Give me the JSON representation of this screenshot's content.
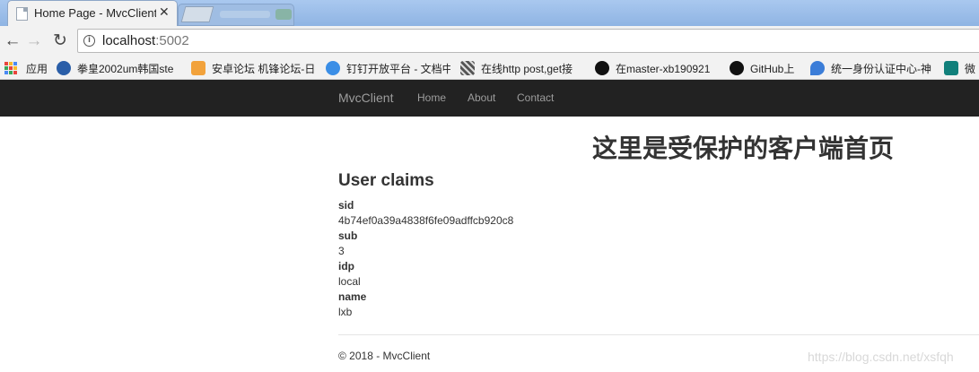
{
  "browser": {
    "tab": {
      "title": "Home Page - MvcClient",
      "close": "✕"
    },
    "toolbar": {
      "back": "←",
      "forward": "→",
      "reload": "↻"
    },
    "address": {
      "host": "localhost",
      "port": ":5002",
      "info": "i"
    },
    "bookmarks": [
      {
        "label": "应用",
        "icon": "apps-grid-icon"
      },
      {
        "label": "拳皇2002um韩国ste",
        "icon": "cloud-icon",
        "color": "#2a5ea8"
      },
      {
        "label": "安卓论坛 机锋论坛-日",
        "icon": "gfan-icon",
        "color": "#f2a23b"
      },
      {
        "label": "钉钉开放平台 - 文档中",
        "icon": "dingtalk-icon",
        "color": "#3a8ee6"
      },
      {
        "label": "在线http post,get接",
        "icon": "qrcode-icon",
        "color": "#555555"
      },
      {
        "label": "在master-xb190921",
        "icon": "github-icon",
        "color": "#111111"
      },
      {
        "label": "GitHub上",
        "icon": "github-icon",
        "color": "#111111"
      },
      {
        "label": "统一身份认证中心-神",
        "icon": "pin-icon",
        "color": "#3b7dd8"
      },
      {
        "label": "微",
        "icon": "bing-icon",
        "color": "#11807b"
      }
    ]
  },
  "navbar": {
    "brand": "MvcClient",
    "links": [
      "Home",
      "About",
      "Contact"
    ]
  },
  "page": {
    "heading": "这里是受保护的客户端首页",
    "claims_title": "User claims",
    "claims": [
      {
        "key": "sid",
        "value": "4b74ef0a39a4838f6fe09adffcb920c8"
      },
      {
        "key": "sub",
        "value": "3"
      },
      {
        "key": "idp",
        "value": "local"
      },
      {
        "key": "name",
        "value": "lxb"
      }
    ],
    "footer": "© 2018 - MvcClient",
    "watermark": "https://blog.csdn.net/xsfqh"
  }
}
